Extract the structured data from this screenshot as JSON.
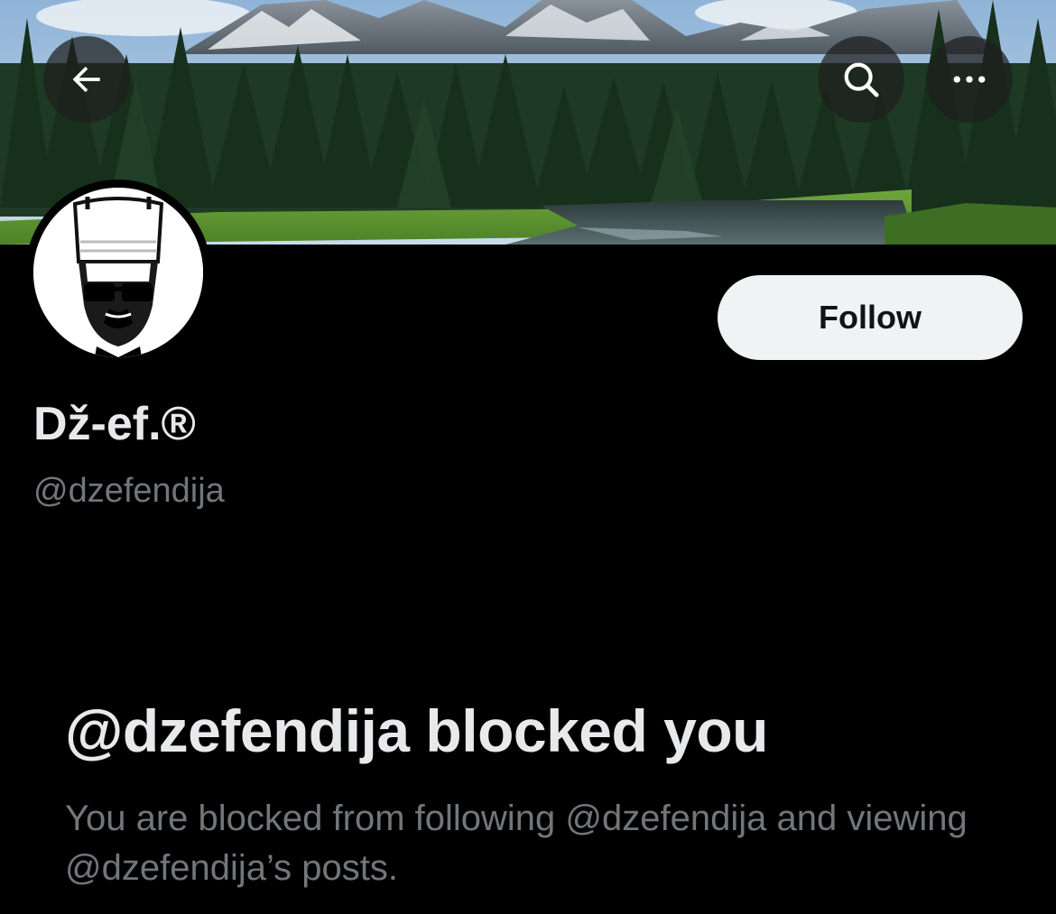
{
  "header": {
    "back_icon": "arrow-left-icon",
    "search_icon": "search-icon",
    "more_icon": "more-horizontal-icon"
  },
  "profile": {
    "display_name": "Dž-ef.®",
    "handle": "@dzefendija",
    "follow_label": "Follow"
  },
  "blocked": {
    "title": "@dzefendija blocked you",
    "description": "You are blocked from following @dzefendija and viewing @dzefendija’s posts."
  },
  "colors": {
    "background": "#000000",
    "primary_text": "#e7e9ea",
    "secondary_text": "#71767b",
    "follow_button_bg": "#eff3f4",
    "follow_button_text": "#0f1419"
  }
}
